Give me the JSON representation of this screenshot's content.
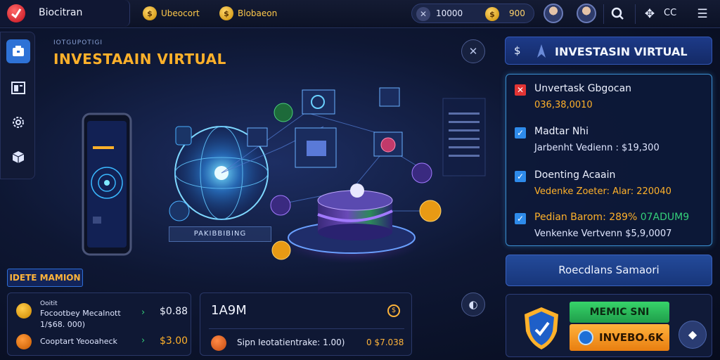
{
  "topbar": {
    "app_title": "Biocitran",
    "chip1_label": "Ubeocort",
    "chip2_label": "Blobaeon",
    "balance_value": "10000",
    "coin_value": "900",
    "cc_label": "CC"
  },
  "sidebar": {
    "items": [
      {
        "icon": "wallet-icon"
      },
      {
        "icon": "document-icon"
      },
      {
        "icon": "gear-icon"
      },
      {
        "icon": "box-icon"
      }
    ]
  },
  "hero": {
    "subtitle": "IOTGUPOTIGI",
    "title": "INVESTAAIN VIRTUAL",
    "scene_label": "PAKIBBIBING"
  },
  "right_panel": {
    "header_title": "INVESTASIN VIRTUAL",
    "items": [
      {
        "title": "Unvertask Gbgocan",
        "detail": "036,38,0010",
        "detail_color": "#ffb12a",
        "check": "red"
      },
      {
        "title": "Madtar Nhi",
        "detail": "Jarbenht Vedienn : $19,300",
        "detail_color": "#dfe6ff",
        "check": "blue"
      },
      {
        "title": "Doenting Acaain",
        "detail": "Vedenke Zoeter: Alar: 220040",
        "detail_color": "#ffb12a",
        "check": "blue"
      },
      {
        "title": "Pedian Barom: 289%",
        "title_extra": "07ADUM9",
        "detail": "Venkenke Vertvenn $5,9,0007",
        "detail_color": "#dfe6ff",
        "check": "blue"
      }
    ],
    "button_label": "Roecdlans Samaori",
    "promo_top": "MEMIC SNI",
    "promo_bottom": "INVEBO.6K"
  },
  "bottom_left": {
    "tag_label": "IDETE MAMION",
    "card_a": {
      "row1_label_line1": "Ooitit",
      "row1_label_line2": "Focootbey Mecalnott",
      "row1_label_line3": "1/$68. 000)",
      "row1_amount": "$0.88",
      "row2_label": "Cooptart Yeooaheck",
      "row2_amount": "$3.00"
    },
    "card_b": {
      "big_label": "1A9M",
      "item_text": "Sipn Ieotatientrake: 1.00)",
      "item_amount": "0 $7.038"
    }
  },
  "colors": {
    "accent_orange": "#ffb12a",
    "accent_green": "#34d07a",
    "accent_blue": "#2e72d6"
  }
}
